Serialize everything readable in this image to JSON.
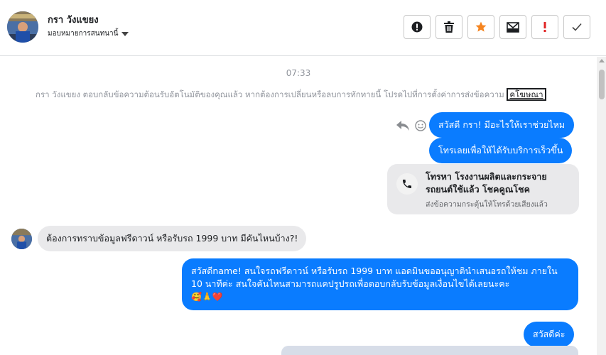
{
  "header": {
    "contact_name": "กรา วังแขยง",
    "assign_label": "มอบหมายการสนทนานี้"
  },
  "toolbar": {
    "buttons": [
      {
        "name": "info-button",
        "icon": "alert-circle-icon"
      },
      {
        "name": "delete-button",
        "icon": "trash-icon"
      },
      {
        "name": "star-button",
        "icon": "star-icon",
        "color": "#f5841f"
      },
      {
        "name": "archive-button",
        "icon": "mail-archive-icon"
      },
      {
        "name": "spam-button",
        "icon": "exclamation-icon",
        "color": "#e02424"
      },
      {
        "name": "done-button",
        "icon": "check-icon"
      }
    ]
  },
  "conversation": {
    "timestamp": "07:33",
    "notice_text": "กรา วังแขยง ตอบกลับข้อความต้อนรับอัตโนมัติของคุณแล้ว หากต้องการเปลี่ยนหรือลบการทักทายนี้ โปรดไปที่การตั้งค่าการส่งข้อความ",
    "notice_link": "คโฆษณา",
    "messages": {
      "out_1": "สวัสดี กรา! มีอะไรให้เราช่วยไหม",
      "out_2": "โทรเลยเพื่อให้ได้รับบริการเร็วขึ้น",
      "call_card_title": "โทรหา โรงงานผลิตและกระจายรถยนต์ใช้แล้ว โชคคูณโชค",
      "call_card_sub": "ส่งข้อความกระตุ้นให้โทรด้วยเสียงแล้ว",
      "in_1": "ต้องการทราบข้อมูลฟรีดาวน์ หรือรับรถ 1999 บาท มีคันไหนบ้าง?!",
      "out_3": "สวัสดีname! สนใจรถฟรีดาวน์ หรือรับรถ 1999 บาท แอดมินขออนุญาตินำเสนอรถให้ชม ภายใน 10 นาทีค่ะ สนใจคันไหนสามารถแคปรูปรถเพื่อตอบกลับรับข้อมูลเงื่อนไขได้เลยนะคะ",
      "out_3_emojis": "🥰🙏❤️",
      "out_4": "สวัสดีค่ะ"
    }
  },
  "colors": {
    "outgoing_bubble": "#0a7cff",
    "incoming_bubble": "#e9e9eb",
    "muted_text": "#90949c"
  }
}
